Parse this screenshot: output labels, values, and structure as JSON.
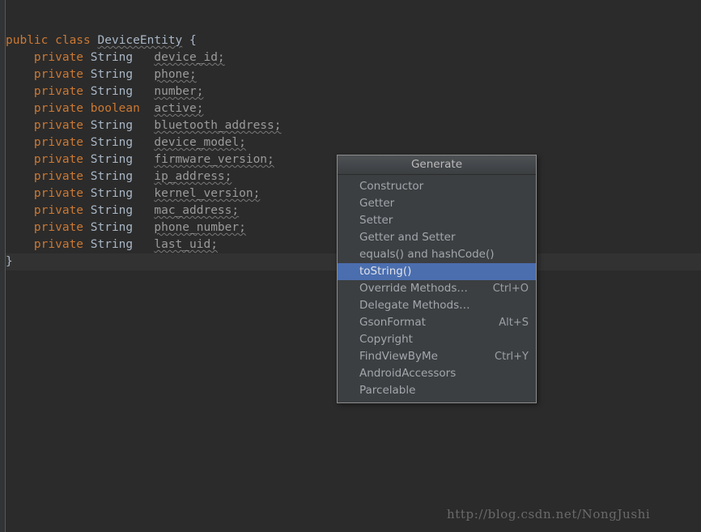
{
  "editor": {
    "background_color": "#2b2b2b",
    "gutter_color": "#313335",
    "caret_line_color": "#323232",
    "colors": {
      "keyword": "#cc7832",
      "type": "#a9b7c6",
      "field": "#9b9b9b",
      "squiggle": "#787878"
    },
    "code_lines": [
      {
        "indent": 0,
        "keyword": "public",
        "keyword2": "class",
        "name": "DeviceEntity",
        "tail": " {"
      },
      {
        "indent": 1,
        "keyword": "private",
        "type": "String",
        "field": "device_id;"
      },
      {
        "indent": 1,
        "keyword": "private",
        "type": "String",
        "field": "phone;"
      },
      {
        "indent": 1,
        "keyword": "private",
        "type": "String",
        "field": "number;"
      },
      {
        "indent": 1,
        "keyword": "private",
        "type": "boolean",
        "field": "active;"
      },
      {
        "indent": 1,
        "keyword": "private",
        "type": "String",
        "field": "bluetooth_address;"
      },
      {
        "indent": 1,
        "keyword": "private",
        "type": "String",
        "field": "device_model;"
      },
      {
        "indent": 1,
        "keyword": "private",
        "type": "String",
        "field": "firmware_version;"
      },
      {
        "indent": 1,
        "keyword": "private",
        "type": "String",
        "field": "ip_address;"
      },
      {
        "indent": 1,
        "keyword": "private",
        "type": "String",
        "field": "kernel_version;"
      },
      {
        "indent": 1,
        "keyword": "private",
        "type": "String",
        "field": "mac_address;"
      },
      {
        "indent": 1,
        "keyword": "private",
        "type": "String",
        "field": "phone_number;"
      },
      {
        "indent": 1,
        "keyword": "private",
        "type": "String",
        "field": "last_uid;"
      },
      {
        "indent": 0,
        "closing": "}"
      }
    ],
    "line1": {
      "kw_public": "public",
      "kw_class": "class",
      "class_name": "DeviceEntity",
      "brace": "{"
    },
    "closing_brace": "}"
  },
  "popup": {
    "title": "Generate",
    "selection_color": "#4b6eaf",
    "items": [
      {
        "label": "Constructor",
        "shortcut": "",
        "selected": false
      },
      {
        "label": "Getter",
        "shortcut": "",
        "selected": false
      },
      {
        "label": "Setter",
        "shortcut": "",
        "selected": false
      },
      {
        "label": "Getter and Setter",
        "shortcut": "",
        "selected": false
      },
      {
        "label": "equals() and hashCode()",
        "shortcut": "",
        "selected": false
      },
      {
        "label": "toString()",
        "shortcut": "",
        "selected": true
      },
      {
        "label": "Override Methods…",
        "shortcut": "Ctrl+O",
        "selected": false
      },
      {
        "label": "Delegate Methods…",
        "shortcut": "",
        "selected": false
      },
      {
        "label": "GsonFormat",
        "shortcut": "Alt+S",
        "selected": false
      },
      {
        "label": "Copyright",
        "shortcut": "",
        "selected": false
      },
      {
        "label": "FindViewByMe",
        "shortcut": "Ctrl+Y",
        "selected": false
      },
      {
        "label": "AndroidAccessors",
        "shortcut": "",
        "selected": false
      },
      {
        "label": "Parcelable",
        "shortcut": "",
        "selected": false
      }
    ]
  },
  "watermark": {
    "text": "http://blog.csdn.net/NongJushi"
  }
}
